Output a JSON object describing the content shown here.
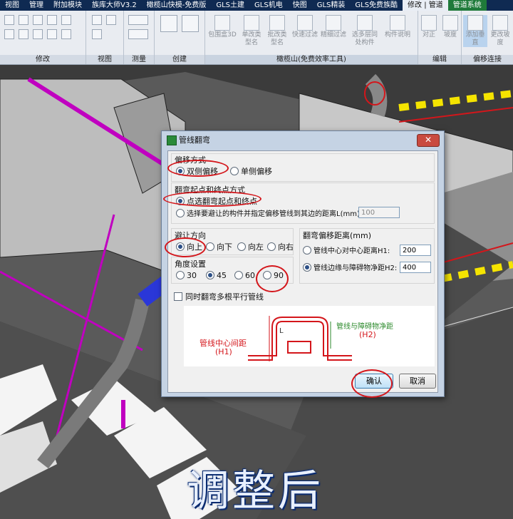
{
  "ribbon": {
    "tabs": [
      "视图",
      "管理",
      "附加模块",
      "族库大师V3.2",
      "橄榄山快模-免费版",
      "GLS土建",
      "GLS机电",
      "快图",
      "GLS精装",
      "GLS免费族酷",
      "修改 | 管道",
      "管道系统"
    ],
    "panels": {
      "modify": "修改",
      "view": "视图",
      "measure": "测量",
      "create": "创建",
      "gls": "橄榄山(免费效率工具)",
      "edit": "编辑",
      "pipe_connect": "偏移连接"
    },
    "tools": {
      "bbox3d": "包围盒3D",
      "single_type": "单改类型名",
      "batch_type": "批改类型名",
      "quick_filter": "快速过滤",
      "fine_filter": "精细过滤",
      "multi_layer": "选多层同处构件",
      "component_desc": "构件说明",
      "align": "对正",
      "slope": "坡度",
      "add_vertical": "添加垂直",
      "change_slope": "更改坡度"
    }
  },
  "dialog": {
    "title": "管线翻弯",
    "close": "✕",
    "offset_mode": {
      "title": "偏移方式",
      "options": [
        "双侧偏移",
        "单侧偏移"
      ],
      "selected": 0
    },
    "start_end": {
      "title": "翻弯起点和终点方式",
      "options": [
        "点选翻弯起点和终点",
        "选择要避让的构件并指定偏移管线到其边的距离L(mm):"
      ],
      "selected": 0,
      "distance_value": "100"
    },
    "direction": {
      "title": "避让方向",
      "options": [
        "向上",
        "向下",
        "向左",
        "向右"
      ],
      "selected": 0
    },
    "angle": {
      "title": "角度设置",
      "options": [
        "30",
        "45",
        "60",
        "90"
      ],
      "selected": 1
    },
    "multi_pipe_label": "同时翻弯多根平行管线",
    "bend_distance": {
      "title": "翻弯偏移距离(mm)",
      "options": [
        "管线中心对中心距离H1:",
        "管线边缘与障碍物净距H2:"
      ],
      "selected": 1,
      "h1_value": "200",
      "h2_value": "400"
    },
    "diagram": {
      "left_label": "管线中心间距",
      "left_sub": "(H1)",
      "right_label": "管线与障碍物净距",
      "right_sub": "(H2)",
      "l_label": "L"
    },
    "ok": "确认",
    "cancel": "取消"
  },
  "caption": "调整后",
  "colors": {
    "annotation_red": "#d4161b",
    "pipe_magenta": "#c000c0",
    "road_yellow": "#f5e400"
  }
}
